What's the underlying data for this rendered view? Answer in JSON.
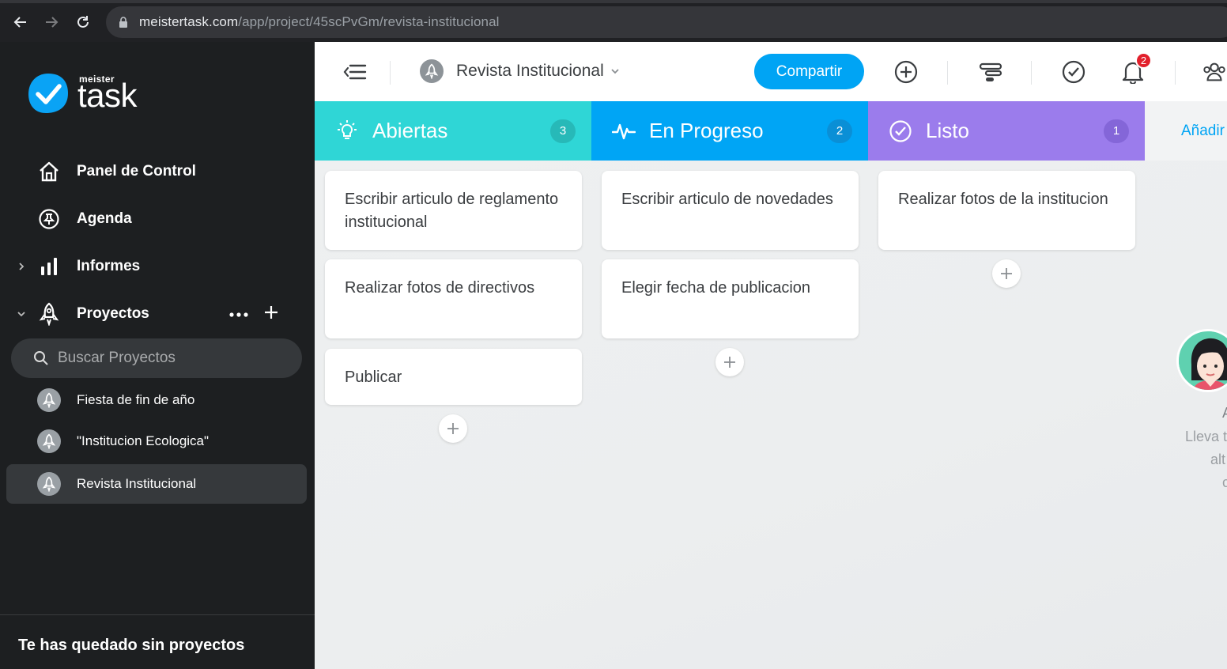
{
  "browser": {
    "url_host": "meistertask.com",
    "url_path": "/app/project/45scPvGm/revista-institucional"
  },
  "sidebar": {
    "logo_small": "meister",
    "logo_big": "task",
    "nav": [
      {
        "label": "Panel de Control",
        "icon": "home-icon"
      },
      {
        "label": "Agenda",
        "icon": "pin-icon"
      },
      {
        "label": "Informes",
        "icon": "bar-chart-icon"
      },
      {
        "label": "Proyectos",
        "icon": "rocket-icon"
      }
    ],
    "search_placeholder": "Buscar Proyectos",
    "projects": [
      {
        "label": "Fiesta de fin de año"
      },
      {
        "label": "\"Institucion Ecologica\""
      },
      {
        "label": "Revista Institucional",
        "active": true
      }
    ],
    "footer": "Te has quedado sin proyectos"
  },
  "topbar": {
    "project_title": "Revista Institucional",
    "share_label": "Compartir",
    "notification_count": "2"
  },
  "board": {
    "columns": [
      {
        "title": "Abiertas",
        "count": "3",
        "color": "#2fd6d6",
        "badge": "#27b9b8",
        "icon": "lightbulb-icon",
        "tasks": [
          "Escribir articulo de reglamento institucional",
          "Realizar fotos de directivos",
          "Publicar"
        ]
      },
      {
        "title": "En Progreso",
        "count": "2",
        "color": "#00a5f5",
        "badge": "#0a8fd6",
        "icon": "activity-icon",
        "tasks": [
          "Escribir articulo de novedades",
          "Elegir fecha de publicacion"
        ]
      },
      {
        "title": "Listo",
        "count": "1",
        "color": "#9b7cec",
        "badge": "#8466d8",
        "icon": "check-circle-icon",
        "tasks": [
          "Realizar fotos de la institucion"
        ]
      }
    ],
    "add_column_label": "Añadir sección",
    "empty_lines": [
      "A",
      "Lleva t",
      "alt",
      "c"
    ]
  }
}
